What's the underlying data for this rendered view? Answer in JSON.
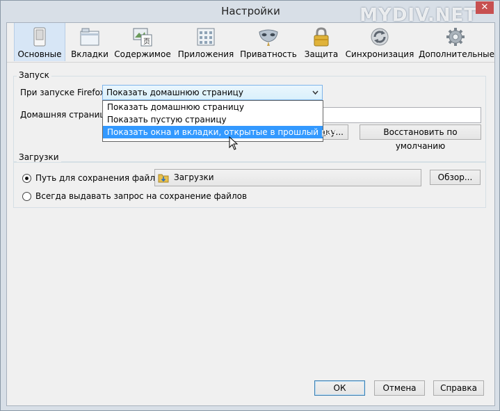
{
  "window": {
    "title": "Настройки",
    "watermark": "MYDIV.NET",
    "close_glyph": "✕"
  },
  "toolbar": {
    "tabs": [
      {
        "label": "Основные",
        "icon": "switch-icon",
        "active": true
      },
      {
        "label": "Вкладки",
        "icon": "window-tabs-icon"
      },
      {
        "label": "Содержимое",
        "icon": "content-icon"
      },
      {
        "label": "Приложения",
        "icon": "applications-icon"
      },
      {
        "label": "Приватность",
        "icon": "mask-icon"
      },
      {
        "label": "Защита",
        "icon": "padlock-icon"
      },
      {
        "label": "Синхронизация",
        "icon": "sync-icon"
      },
      {
        "label": "Дополнительные",
        "icon": "gear-icon"
      }
    ]
  },
  "startup": {
    "group_title": "Запуск",
    "on_start_label": "При запуске Firefox:",
    "selected_option": "Показать домашнюю страницу",
    "options": [
      "Показать домашнюю страницу",
      "Показать пустую страницу",
      "Показать окна и вкладки, открытые в прошлый раз"
    ],
    "highlighted_index": 2,
    "homepage_label": "Домашняя страница:",
    "homepage_value": "",
    "use_bookmark_partial": "дку...",
    "restore_default_label": "Восстановить по умолчанию"
  },
  "downloads": {
    "group_title": "Загрузки",
    "save_path_label": "Путь для сохранения файлов",
    "folder_name": "Загрузки",
    "browse_label": "Обзор...",
    "always_ask_label": "Всегда выдавать запрос на сохранение файлов",
    "save_path_selected": true
  },
  "footer": {
    "ok_label": "ОК",
    "cancel_label": "Отмена",
    "help_label": "Справка"
  }
}
